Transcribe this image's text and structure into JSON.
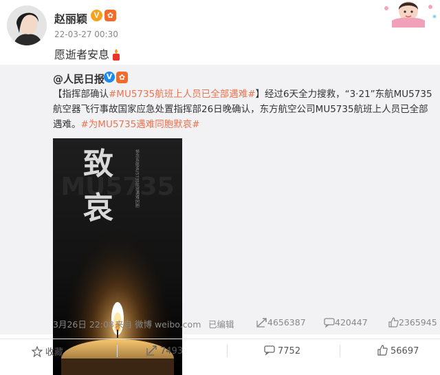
{
  "post": {
    "username": "赵丽颖",
    "timestamp": "22-03-27 00:30",
    "text": "愿逝者安息"
  },
  "repost": {
    "author": "@人民日报",
    "body_prefix": "【指挥部确认",
    "hashtag1": "#MU5735航班上人员已全部遇难#",
    "body_main": "】经过6天全力搜救，“3·21”东航MU5735航空器飞行事故国家应急处置指挥部26日晚确认，东方航空公司MU5735航班上人员已全部遇难。",
    "hashtag2": "#为MU5735遇难同胞默哀#",
    "poster": {
      "char1": "致",
      "char2": "哀",
      "bg_text": "MU5735",
      "vertical_text": "悼念东航MU5735航班遇难同胞"
    },
    "meta": {
      "date": "3月26日 22:08",
      "source": "来自 微博 weibo.com",
      "edited": "已编辑",
      "reposts": "4656387",
      "comments": "420447",
      "likes": "2365945"
    }
  },
  "actions": {
    "collect": "收藏",
    "repost": "7493",
    "comment": "7752",
    "like": "56697"
  },
  "colors": {
    "link": "#eb7350",
    "verified_orange": "#f7a21c",
    "verified_blue": "#1a8af5"
  }
}
